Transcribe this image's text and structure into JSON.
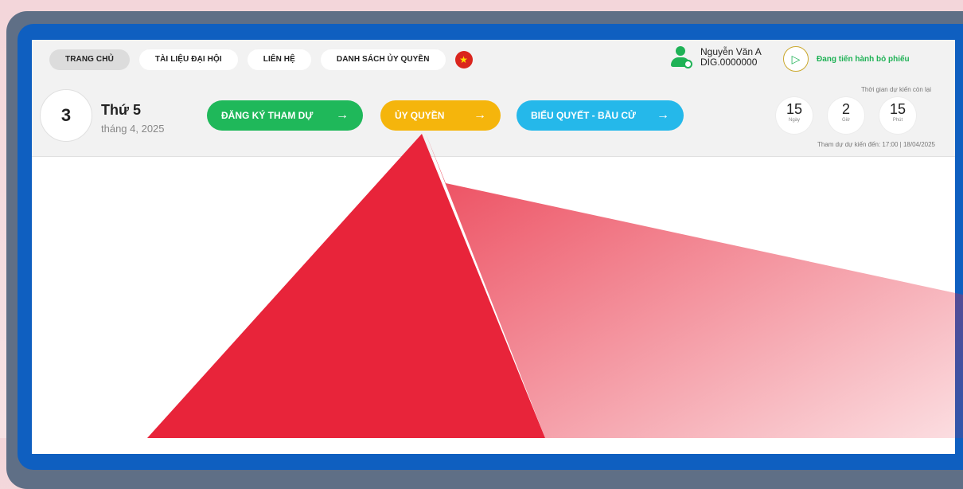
{
  "nav": {
    "items": [
      "TRANG CHỦ",
      "TÀI LIỆU ĐẠI HỘI",
      "LIÊN HỆ",
      "DANH SÁCH ỦY QUYỀN"
    ],
    "flag_icon": "vietnam-flag-icon"
  },
  "user": {
    "name": "Nguyễn Văn A",
    "id": "DIG.0000000",
    "avatar_icon": "user-settings-icon"
  },
  "voting_status": {
    "label": "Đang tiến hành bỏ phiếu",
    "icon": "vote-send-icon"
  },
  "date": {
    "day": "3",
    "weekday": "Thứ 5",
    "month_year": "tháng 4, 2025"
  },
  "actions": {
    "register": "ĐĂNG KÝ THAM DỰ",
    "proxy": "ỦY QUYỀN",
    "vote": "BIỂU QUYẾT - BẦU CỬ",
    "arrow": "→"
  },
  "countdown": {
    "caption": "Thời gian dự kiến còn lại",
    "days": {
      "value": "15",
      "unit": "Ngày"
    },
    "hours": {
      "value": "2",
      "unit": "Giờ"
    },
    "minutes": {
      "value": "15",
      "unit": "Phút"
    },
    "deadline": "Tham dự dự kiến đến: 17:00 | 18/04/2025"
  },
  "colors": {
    "register": "#1fb85a",
    "proxy": "#f5b50c",
    "vote": "#25b8ea",
    "frame": "#0f5fc0",
    "highlight": "#e8243a"
  }
}
